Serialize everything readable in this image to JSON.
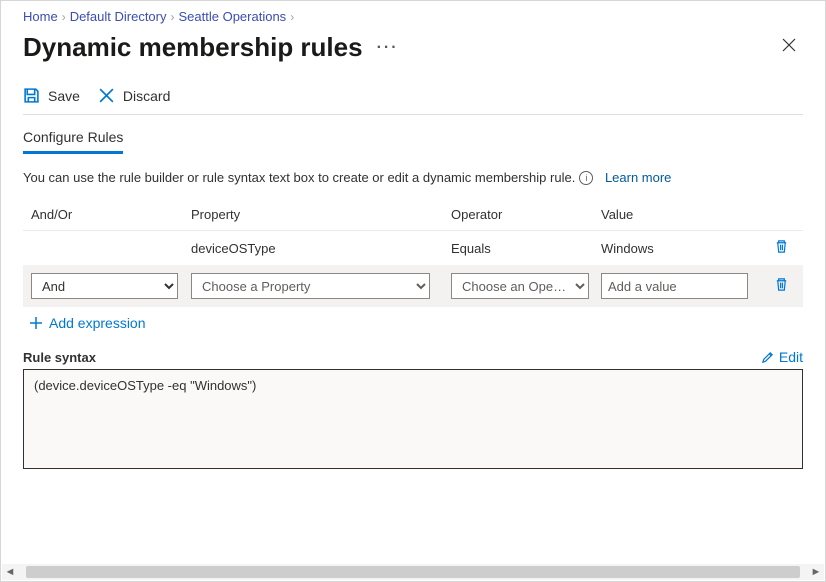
{
  "breadcrumb": {
    "home": "Home",
    "dir": "Default Directory",
    "group": "Seattle Operations"
  },
  "page_title": "Dynamic membership rules",
  "toolbar": {
    "save": "Save",
    "discard": "Discard"
  },
  "tab": {
    "configure": "Configure Rules"
  },
  "desc": {
    "text": "You can use the rule builder or rule syntax text box to create or edit a dynamic membership rule.",
    "learn_more": "Learn more"
  },
  "table": {
    "headers": {
      "andor": "And/Or",
      "property": "Property",
      "operator": "Operator",
      "value": "Value"
    },
    "row1": {
      "andor": "",
      "property": "deviceOSType",
      "operator": "Equals",
      "value": "Windows"
    },
    "row2": {
      "andor_selected": "And",
      "property_placeholder": "Choose a Property",
      "operator_placeholder": "Choose an Ope…",
      "value_placeholder": "Add a value"
    }
  },
  "add_expression": "Add expression",
  "syntax": {
    "label": "Rule syntax",
    "edit": "Edit",
    "content": "(device.deviceOSType -eq \"Windows\")"
  }
}
